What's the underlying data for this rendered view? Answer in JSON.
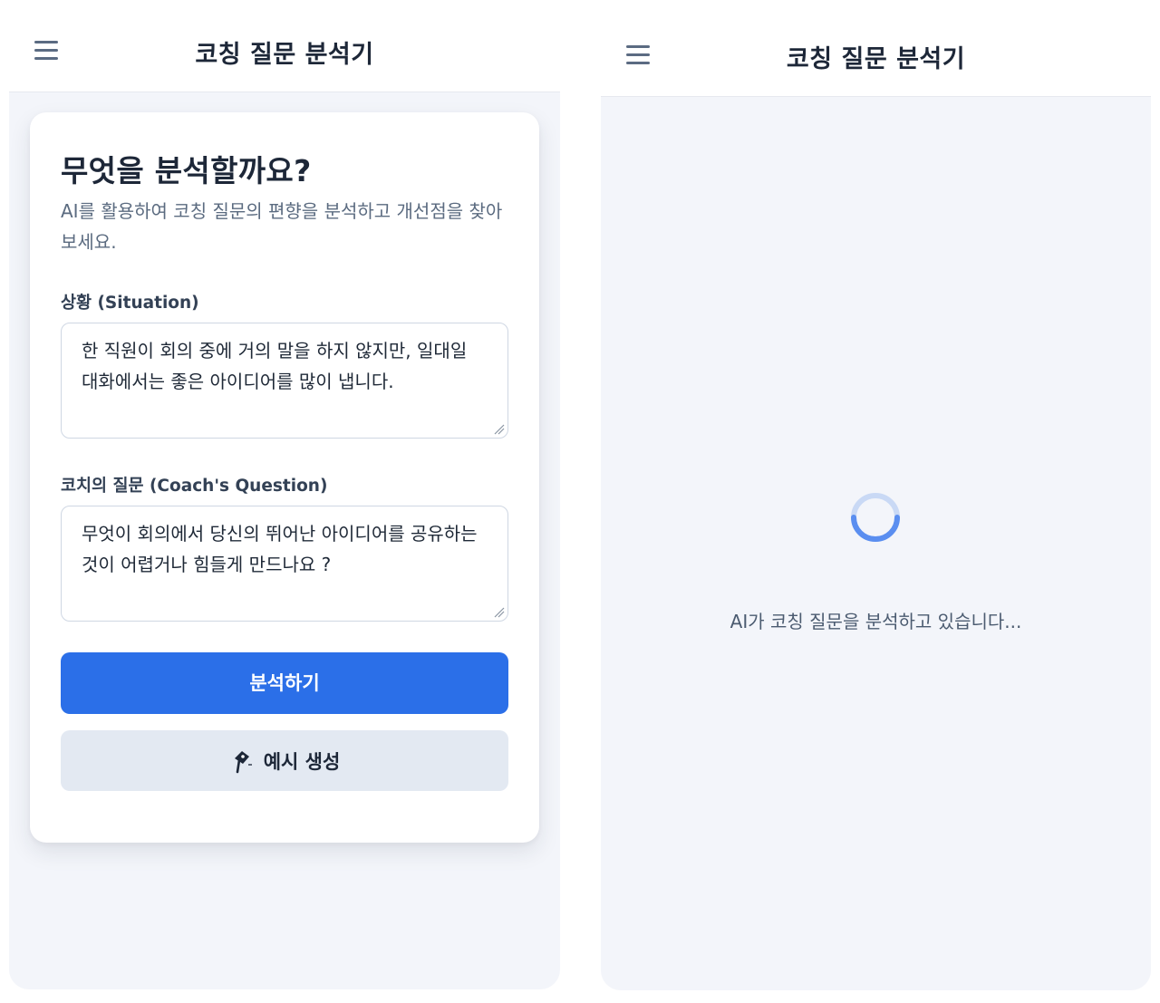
{
  "app": {
    "title": "코칭 질문 분석기"
  },
  "form_screen": {
    "heading": "무엇을 분석할까요?",
    "description": "AI를 활용하여 코칭 질문의 편향을 분석하고 개선점을 찾아보세요.",
    "situation": {
      "label": "상황 (Situation)",
      "value": "한 직원이 회의 중에 거의 말을 하지 않지만, 일대일 대화에서는 좋은 아이디어를 많이 냅니다."
    },
    "question": {
      "label": "코치의 질문 (Coach's Question)",
      "value": "무엇이 회의에서 당신의 뛰어난 아이디어를 공유하는 것이 어렵거나 힘들게 만드나요 ?"
    },
    "analyze_button": "분석하기",
    "example_button": {
      "icon": "pin-icon",
      "label": "예시 생성"
    }
  },
  "loading_screen": {
    "message": "AI가 코칭 질문을 분석하고 있습니다..."
  },
  "colors": {
    "primary": "#2b6fe8",
    "secondary_button_bg": "#e3e9f2",
    "screen_bg": "#f3f5fa",
    "spinner_track": "#c9d9f5",
    "spinner_arc": "#5a8ef0"
  }
}
